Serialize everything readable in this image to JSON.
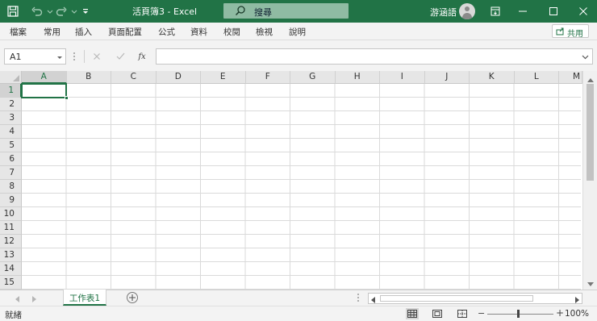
{
  "title_bar": {
    "title": "活頁簿3  -  Excel",
    "search_placeholder": "搜尋",
    "user_name": "游涵語",
    "icons": [
      "save-icon",
      "undo-icon",
      "redo-icon",
      "customize-toolbar-icon",
      "search-icon",
      "avatar",
      "ribbon-display-icon",
      "minimize-icon",
      "maximize-icon",
      "close-icon"
    ]
  },
  "menu": {
    "items": [
      "檔案",
      "常用",
      "插入",
      "頁面配置",
      "公式",
      "資料",
      "校閱",
      "檢視",
      "說明"
    ],
    "share_label": "共用"
  },
  "formula_bar": {
    "name_box": "A1",
    "fx_label": "fx",
    "formula_value": ""
  },
  "grid": {
    "columns": [
      "A",
      "B",
      "C",
      "D",
      "E",
      "F",
      "G",
      "H",
      "I",
      "J",
      "K",
      "L",
      "M"
    ],
    "rows": [
      "1",
      "2",
      "3",
      "4",
      "5",
      "6",
      "7",
      "8",
      "9",
      "10",
      "11",
      "12",
      "13",
      "14",
      "15"
    ],
    "active_cell": "A1"
  },
  "sheets": {
    "tabs": [
      "工作表1"
    ],
    "active": "工作表1"
  },
  "status_bar": {
    "status": "就緒",
    "zoom": "100%"
  },
  "colors": {
    "brand": "#217346",
    "gridline": "#dadada",
    "header_bg": "#e6e6e6"
  }
}
